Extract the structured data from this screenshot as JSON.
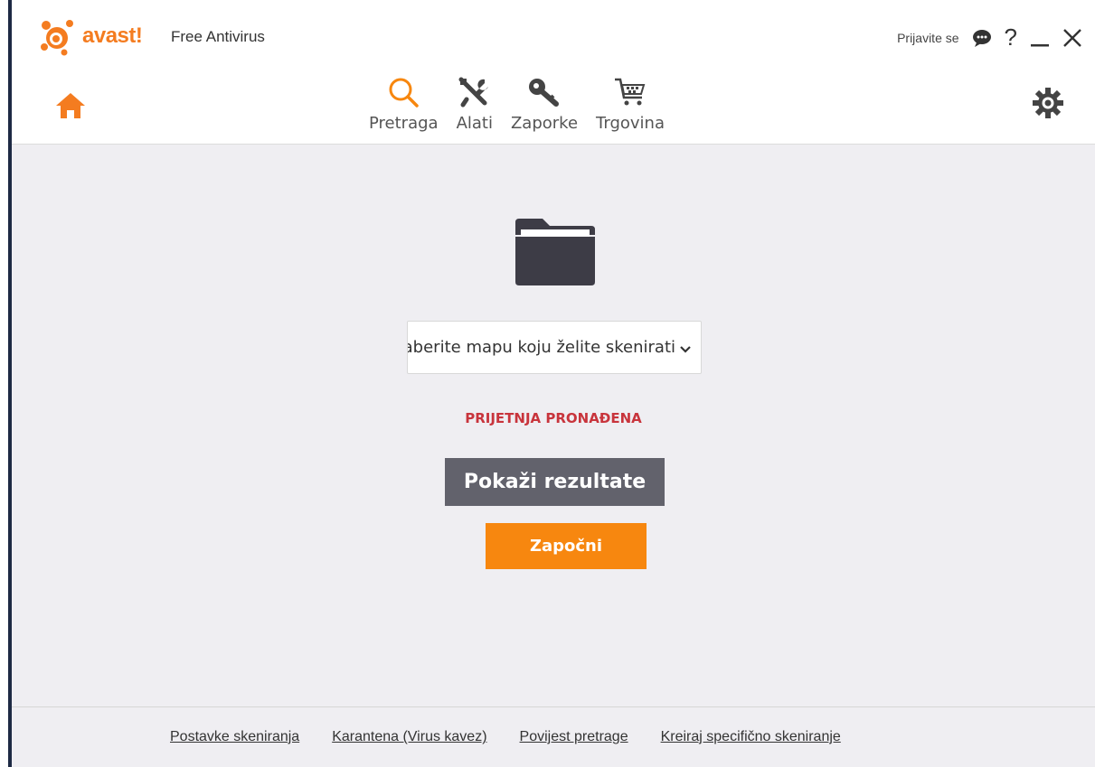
{
  "app": {
    "logo_text": "avast!",
    "product_name": "Free Antivirus"
  },
  "topbar": {
    "signin_label": "Prijavite se",
    "icons": [
      "chat-icon",
      "help-icon",
      "minimize-icon",
      "close-icon"
    ],
    "help_glyph": "?"
  },
  "nav": {
    "items": [
      {
        "label": "Pretraga",
        "icon": "search-icon"
      },
      {
        "label": "Alati",
        "icon": "tools-icon"
      },
      {
        "label": "Zaporke",
        "icon": "key-icon"
      },
      {
        "label": "Trgovina",
        "icon": "cart-icon"
      }
    ]
  },
  "main": {
    "folder_select_value": "Odaberite mapu koju želite skenirati",
    "threat_status": "PRIJETNJA PRONAĐENA",
    "show_results_label": "Pokaži rezultate",
    "start_label": "Započni"
  },
  "footer": {
    "links": [
      "Postavke skeniranja",
      "Karantena (Virus kavez)",
      "Povijest pretrage",
      "Kreiraj specifično skeniranje"
    ]
  },
  "colors": {
    "accent": "#f7870f",
    "threat": "#c8343c",
    "results_button": "#62626c",
    "background": "#efeef2"
  }
}
